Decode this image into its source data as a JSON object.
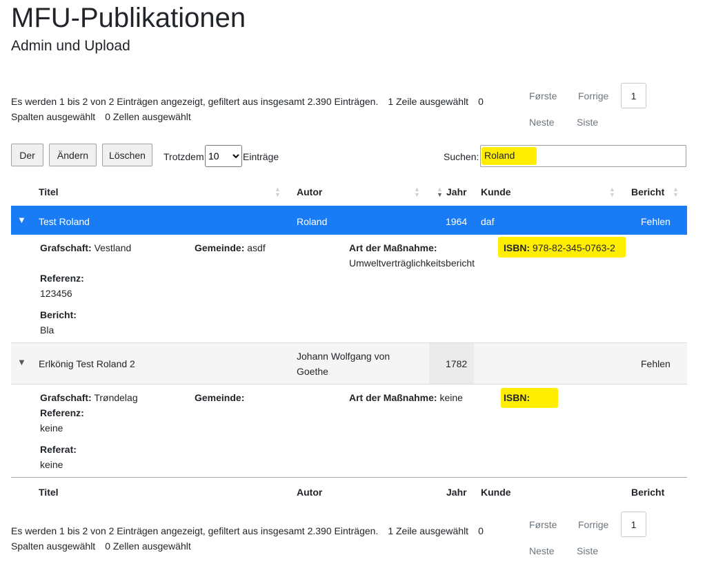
{
  "header": {
    "title": "MFU-Publikationen",
    "subtitle": "Admin und Upload"
  },
  "info": {
    "text": "Es werden 1 bis 2 von 2 Einträgen angezeigt, gefiltert aus insgesamt 2.390 Einträgen.",
    "rows_selected": "1 Zeile ausgewählt",
    "zero_a": "0",
    "cols_selected": "Spalten ausgewählt",
    "cells_selected": "0 Zellen ausgewählt"
  },
  "pagination": {
    "first": "Første",
    "previous": "Forrige",
    "page": "1",
    "next": "Neste",
    "last": "Siste"
  },
  "toolbar": {
    "new_label": "Der",
    "edit_label": "Ändern",
    "delete_label": "Löschen",
    "length_prefix": "Trotzdem",
    "length_value": "10",
    "length_suffix": "Einträge",
    "search_label": "Suchen:",
    "search_value": "Roland"
  },
  "table": {
    "columns": [
      "Titel",
      "Autor",
      "Jahr",
      "Kunde",
      "Bericht"
    ],
    "rows": [
      {
        "titel": "Test Roland",
        "autor": "Roland",
        "jahr": "1964",
        "kunde": "daf",
        "bericht": "Fehlen",
        "details": {
          "grafschaft_label": "Grafschaft:",
          "grafschaft": "Vestland",
          "gemeinde_label": "Gemeinde:",
          "gemeinde": "asdf",
          "massnahme_label": "Art der Maßnahme:",
          "massnahme": "Umweltverträglichkeitsbericht",
          "isbn_label": "ISBN:",
          "isbn": "978-82-345-0763-2",
          "referenz_label": "Referenz:",
          "referenz": "123456",
          "bericht_label": "Bericht:",
          "bericht": "Bla"
        }
      },
      {
        "titel": "Erlkönig Test Roland 2",
        "autor_line1": "Johann Wolfgang von",
        "autor_line2": "Goethe",
        "jahr": "1782",
        "kunde": "",
        "bericht": "Fehlen",
        "details": {
          "grafschaft_label": "Grafschaft:",
          "grafschaft": "Trøndelag",
          "gemeinde_label": "Gemeinde:",
          "gemeinde": "",
          "massnahme_label": "Art der Maßnahme:",
          "massnahme": "keine",
          "isbn_label": "ISBN:",
          "isbn": "",
          "referenz_label": "Referenz:",
          "referenz": "keine",
          "referat_label": "Referat:",
          "referat": "keine"
        }
      }
    ]
  },
  "colors": {
    "selected_row": "#1a7cf5",
    "highlight": "#ffee00"
  }
}
